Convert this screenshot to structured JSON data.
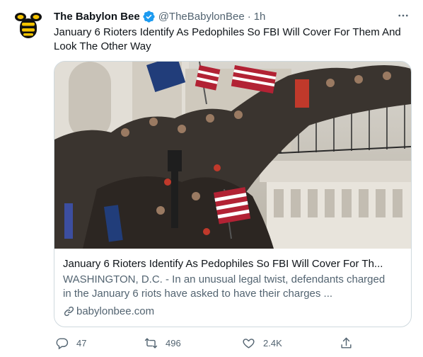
{
  "author": {
    "name": "The Babylon Bee",
    "handle": "@TheBabylonBee",
    "separator": "·",
    "time": "1h",
    "verified": true,
    "avatar_icon": "babylon-bee-logo"
  },
  "tweet": {
    "text": "January 6 Rioters Identify As Pedophiles So FBI Will Cover For Them And Look The Other Way"
  },
  "card": {
    "image_description_icon": "capitol-riot-photo",
    "title": "January 6 Rioters Identify As Pedophiles So FBI Will Cover For Th...",
    "description": "WASHINGTON, D.C. - In an unusual legal twist, defendants charged in the January 6 riots have asked to have their charges ...",
    "domain": "babylonbee.com",
    "domain_icon": "link-icon"
  },
  "actions": {
    "reply_count": "47",
    "retweet_count": "496",
    "like_count": "2.4K"
  },
  "colors": {
    "text_primary": "#0f1419",
    "text_secondary": "#536471",
    "verified_blue": "#1d9bf0",
    "border": "#cfd9de",
    "logo_yellow": "#f5c400"
  }
}
